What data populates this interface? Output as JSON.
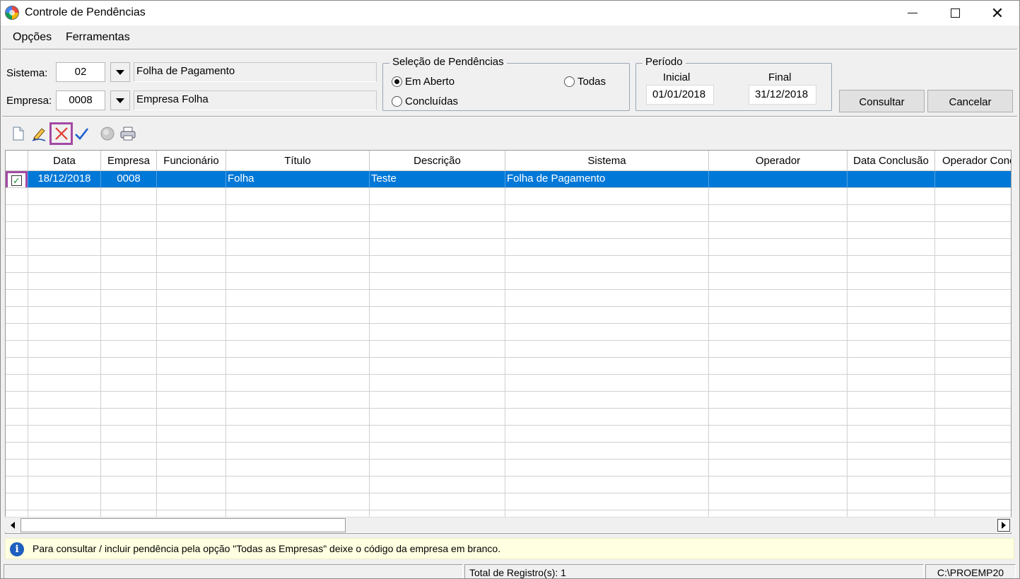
{
  "window": {
    "title": "Controle de Pendências",
    "controls": {
      "minimize": "minimize",
      "maximize": "maximize",
      "close": "close"
    }
  },
  "menu": {
    "items": [
      {
        "label": "Opções"
      },
      {
        "label": "Ferramentas"
      }
    ]
  },
  "filters": {
    "sistema": {
      "label": "Sistema:",
      "code": "02",
      "description": "Folha de Pagamento"
    },
    "empresa": {
      "label": "Empresa:",
      "code": "0008",
      "description": "Empresa Folha"
    }
  },
  "selecao": {
    "title": "Seleção de Pendências",
    "options": [
      {
        "label": "Em Aberto",
        "checked": true
      },
      {
        "label": "Todas",
        "checked": false
      },
      {
        "label": "Concluídas",
        "checked": false
      }
    ]
  },
  "periodo": {
    "title": "Período",
    "inicial_label": "Inicial",
    "inicial_value": "01/01/2018",
    "final_label": "Final",
    "final_value": "31/12/2018"
  },
  "buttons": {
    "consultar": "Consultar",
    "cancelar": "Cancelar"
  },
  "toolbar": {
    "icons": [
      "new-document-icon",
      "edit-pencil-icon",
      "delete-x-icon",
      "confirm-check-icon",
      "globe-icon",
      "printer-icon"
    ]
  },
  "grid": {
    "columns": [
      "",
      "Data",
      "Empresa",
      "Funcionário",
      "Título",
      "Descrição",
      "Sistema",
      "Operador",
      "Data Conclusão",
      "Operador Conc"
    ],
    "rows": [
      {
        "checked": true,
        "data": "18/12/2018",
        "empresa": "0008",
        "funcionario": "",
        "titulo": "Folha",
        "descricao": "Teste",
        "sistema": "Folha de Pagamento",
        "operador": "",
        "data_conclusao": "",
        "operador_conc": ""
      }
    ]
  },
  "info": {
    "text": "Para consultar / incluir pendência pela opção \"Todas as Empresas\" deixe o código da empresa em branco."
  },
  "status": {
    "total": "Total de Registro(s): 1",
    "path": "C:\\PROEMP20"
  },
  "colors": {
    "selection": "#0078d7",
    "highlight_border": "#a349a4",
    "info_bg": "#ffffe1"
  }
}
